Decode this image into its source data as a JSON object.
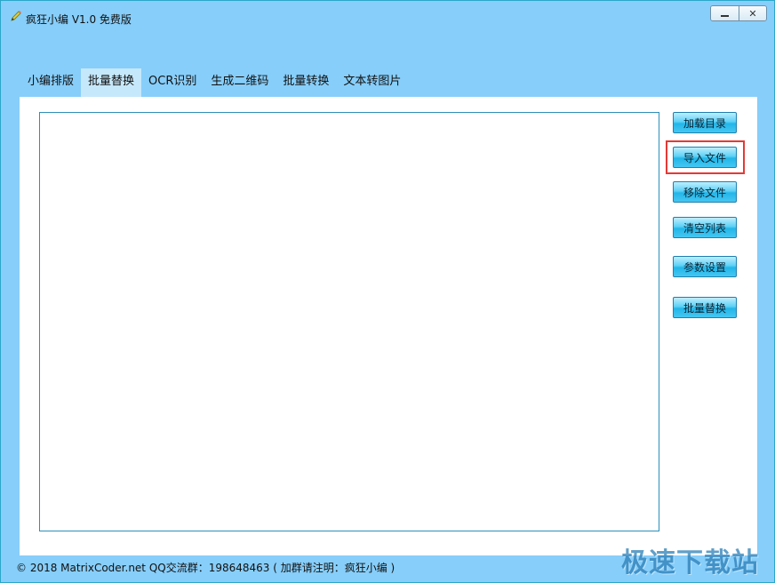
{
  "window": {
    "title": "疯狂小编 V1.0 免费版",
    "icon": "pencil-icon",
    "minimize_icon": "minimize-icon",
    "close_label": "✕"
  },
  "tabs": [
    {
      "label": "小编排版",
      "active": false
    },
    {
      "label": "批量替换",
      "active": true
    },
    {
      "label": "OCR识别",
      "active": false
    },
    {
      "label": "生成二维码",
      "active": false
    },
    {
      "label": "批量转换",
      "active": false
    },
    {
      "label": "文本转图片",
      "active": false
    }
  ],
  "actions": {
    "load_dir": "加载目录",
    "import_file": "导入文件",
    "remove_file": "移除文件",
    "clear_list": "清空列表",
    "settings": "参数设置",
    "batch_replace": "批量替换"
  },
  "status": {
    "text": "© 2018 MatrixCoder.net    QQ交流群：198648463 ( 加群请注明：疯狂小编 )"
  },
  "watermark": "极速下载站",
  "colors": {
    "window_bg": "#87cefa",
    "active_tab": "#c6e8fb",
    "button": "#22b6e8",
    "highlight": "#e53935"
  }
}
